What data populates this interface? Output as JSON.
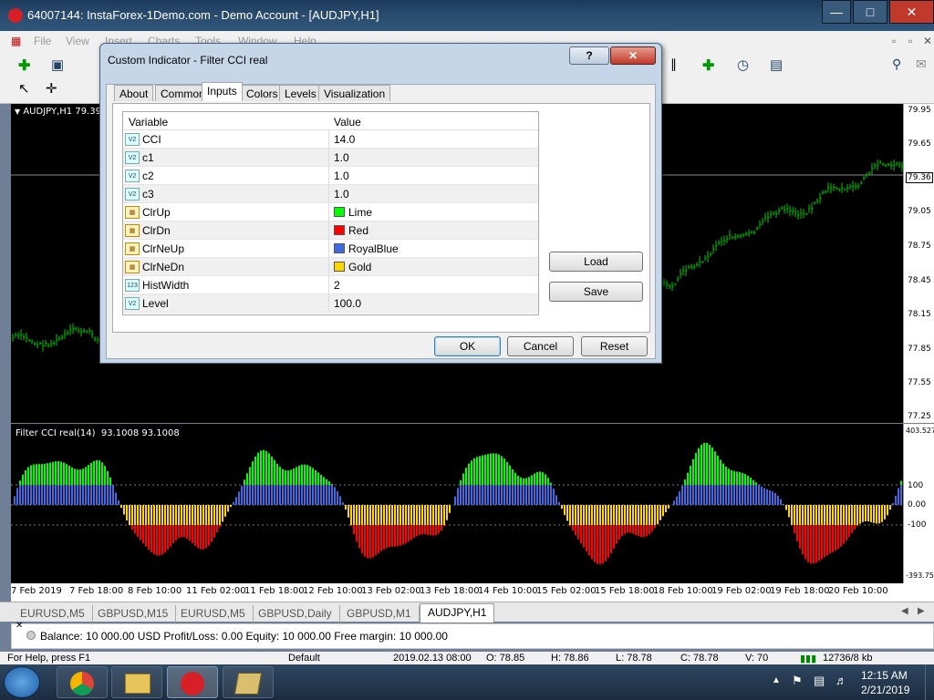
{
  "window": {
    "title": "64007144: InstaForex-1Demo.com - Demo Account - [AUDJPY,H1]"
  },
  "menu": [
    "File",
    "View",
    "Insert",
    "Charts",
    "Tools",
    "Window",
    "Help"
  ],
  "chart": {
    "label": "AUDJPY,H1",
    "label_price": "79.39",
    "current_price": "79.36",
    "price_ticks": [
      "79.95",
      "79.65",
      "79.36",
      "79.05",
      "78.75",
      "78.45",
      "78.15",
      "77.85",
      "77.55",
      "77.25"
    ],
    "indicator_label": "Filter CCI real(14)",
    "indicator_values": "93.1008 93.1008",
    "indicator_ticks": [
      "403.527",
      "100",
      "0.00",
      "-100",
      "-393.75"
    ],
    "time_labels": [
      "7 Feb 2019",
      "7 Feb 18:00",
      "8 Feb 10:00",
      "11 Feb 02:00",
      "11 Feb 18:00",
      "12 Feb 10:00",
      "13 Feb 02:00",
      "13 Feb 18:00",
      "14 Feb 10:00",
      "15 Feb 02:00",
      "15 Feb 18:00",
      "18 Feb 10:00",
      "19 Feb 02:00",
      "19 Feb 18:00",
      "20 Feb 10:00"
    ],
    "colors": {
      "lime": "#00ff00",
      "red": "#ff0000",
      "royalblue": "#4169e1",
      "gold": "#ffd700",
      "bar": "#00c800"
    }
  },
  "symbol_tabs": [
    {
      "label": "EURUSD,M5",
      "active": false
    },
    {
      "label": "GBPUSD,M15",
      "active": false
    },
    {
      "label": "EURUSD,M5",
      "active": false
    },
    {
      "label": "GBPUSD,Daily",
      "active": false
    },
    {
      "label": "GBPUSD,M1",
      "active": false
    },
    {
      "label": "AUDJPY,H1",
      "active": true
    }
  ],
  "account": {
    "text": "Balance: 10 000.00 USD  Profit/Loss: 0.00  Equity: 10 000.00  Free margin: 10 000.00"
  },
  "status": {
    "help": "For Help, press F1",
    "profile": "Default",
    "datetime": "2019.02.13 08:00",
    "open": "O: 78.85",
    "high": "H: 78.86",
    "low": "L: 78.78",
    "close": "C: 78.78",
    "volume": "V: 70",
    "traffic": "12736/8 kb"
  },
  "dialog": {
    "title": "Custom Indicator - Filter CCI real",
    "help_label": "?",
    "tabs": [
      "About",
      "Common",
      "Inputs",
      "Colors",
      "Levels",
      "Visualization"
    ],
    "active_tab": "Inputs",
    "col_variable": "Variable",
    "col_value": "Value",
    "params": [
      {
        "name": "CCI",
        "value": "14.0",
        "type": "num",
        "icon": "V2"
      },
      {
        "name": "c1",
        "value": "1.0",
        "type": "num",
        "icon": "V2"
      },
      {
        "name": "c2",
        "value": "1.0",
        "type": "num",
        "icon": "V2"
      },
      {
        "name": "c3",
        "value": "1.0",
        "type": "num",
        "icon": "V2"
      },
      {
        "name": "ClrUp",
        "value": "Lime",
        "type": "color",
        "swatch": "#00ff00"
      },
      {
        "name": "ClrDn",
        "value": "Red",
        "type": "color",
        "swatch": "#ff0000"
      },
      {
        "name": "ClrNeUp",
        "value": "RoyalBlue",
        "type": "color",
        "swatch": "#4169e1"
      },
      {
        "name": "ClrNeDn",
        "value": "Gold",
        "type": "color",
        "swatch": "#ffd700"
      },
      {
        "name": "HistWidth",
        "value": "2",
        "type": "int",
        "icon": "123"
      },
      {
        "name": "Level",
        "value": "100.0",
        "type": "num",
        "icon": "V2"
      }
    ],
    "load_label": "Load",
    "save_label": "Save",
    "ok_label": "OK",
    "cancel_label": "Cancel",
    "reset_label": "Reset"
  },
  "taskbar": {
    "time": "12:15 AM",
    "date": "2/21/2019"
  }
}
